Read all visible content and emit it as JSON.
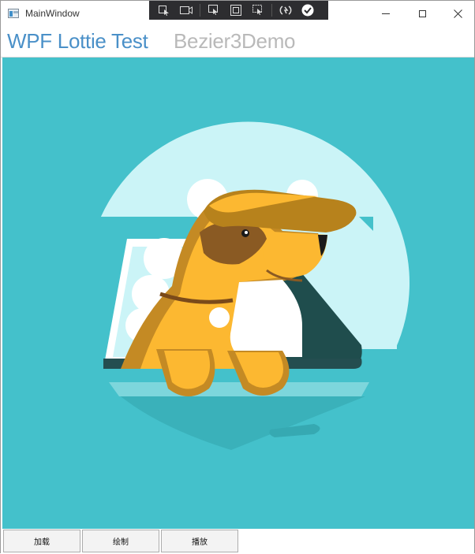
{
  "window": {
    "title": "MainWindow"
  },
  "header": {
    "title": "WPF Lottie Test",
    "subtitle": "Bezier3Demo"
  },
  "debug_toolbar": {
    "icons": [
      "select-element-icon",
      "video-icon",
      "pointer-icon",
      "frame-icon",
      "adorner-icon",
      "hot-reload-icon",
      "check-icon"
    ]
  },
  "buttons": {
    "load": "加载",
    "draw": "绘制",
    "play": "播放"
  },
  "colors": {
    "background": "#44c1cb",
    "circle": "#cbf4f7",
    "dog_body": "#fcb831",
    "dog_shadow": "#c48a24",
    "ear": "#b7821c",
    "car_dark": "#1f4d4d"
  }
}
